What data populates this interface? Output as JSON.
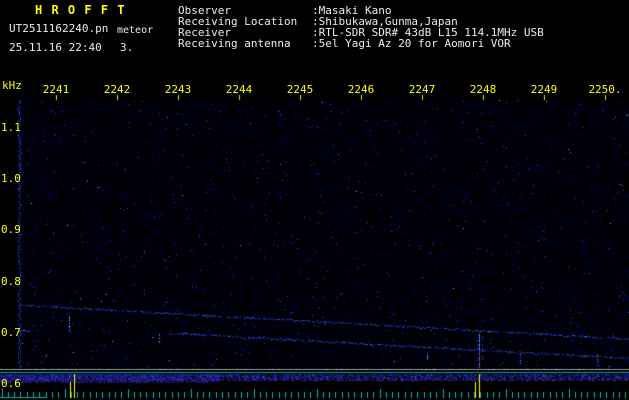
{
  "header": {
    "app_title": "H R O F F T",
    "filename": "UT2511162240.pn",
    "filename_overlay": "meteor",
    "datetime": "25.11.16 22:40",
    "echo_count": "3.",
    "info_rows": [
      {
        "label": "Observer",
        "value": ":Masaki Kano"
      },
      {
        "label": "Receiving Location",
        "value": ":Shibukawa,Gunma,Japan"
      },
      {
        "label": "Receiver",
        "value": ":RTL-SDR SDR# 43dB L15 114.1MHz USB"
      },
      {
        "label": "Receiving antenna",
        "value": ":5el Yagi Az 20 for Aomori VOR"
      }
    ]
  },
  "chart_data": {
    "type": "heatmap",
    "subtype": "radio-meteor-spectrogram",
    "title": "",
    "x_axis": {
      "unit": "UT hhmm",
      "tick_labels": [
        "2241",
        "2242",
        "2243",
        "2244",
        "2245",
        "2246",
        "2247",
        "2248",
        "2249",
        "2250."
      ]
    },
    "y_axis": {
      "label": "kHz",
      "tick_labels": [
        "1.1",
        "1.0",
        "0.9",
        "0.8",
        "0.7",
        "0.6"
      ],
      "range_khz": [
        0.6,
        1.16
      ]
    },
    "carrier_drift_traces": [
      {
        "start": {
          "t_frac": 0.03,
          "khz": 0.752
        },
        "end": {
          "t_frac": 1.0,
          "khz": 0.686
        }
      },
      {
        "start": {
          "t_frac": 0.27,
          "khz": 0.697
        },
        "end": {
          "t_frac": 1.0,
          "khz": 0.648
        }
      }
    ],
    "meteor_echoes": [
      {
        "t_frac": 0.111,
        "khz_top": 0.73,
        "khz_bottom": 0.7,
        "intensity": "medium"
      },
      {
        "t_frac": 0.254,
        "khz_top": 0.705,
        "khz_bottom": 0.68,
        "intensity": "weak"
      },
      {
        "t_frac": 0.68,
        "khz_top": 0.662,
        "khz_bottom": 0.645,
        "intensity": "weak"
      },
      {
        "t_frac": 0.763,
        "khz_top": 0.7,
        "khz_bottom": 0.615,
        "intensity": "strong"
      },
      {
        "t_frac": 0.827,
        "khz_top": 0.655,
        "khz_bottom": 0.638,
        "intensity": "weak"
      },
      {
        "t_frac": 0.95,
        "khz_top": 0.655,
        "khz_bottom": 0.64,
        "intensity": "weak"
      }
    ],
    "level_strip": {
      "spikes": [
        {
          "t_frac": 0.119,
          "strength": "strong"
        },
        {
          "t_frac": 0.763,
          "strength": "strong"
        }
      ]
    },
    "colors": {
      "axis_label": "#ffff00",
      "noise_floor": "#000040",
      "weak_signal": "#2a52e8",
      "medium_signal": "#49c3ff",
      "strong_signal": "#ff2222",
      "separator_white": "#9a9a9a",
      "separator_cyan": "#00a8a8",
      "tick_comb": "#00b8b8",
      "spike": "#ffff00"
    }
  }
}
